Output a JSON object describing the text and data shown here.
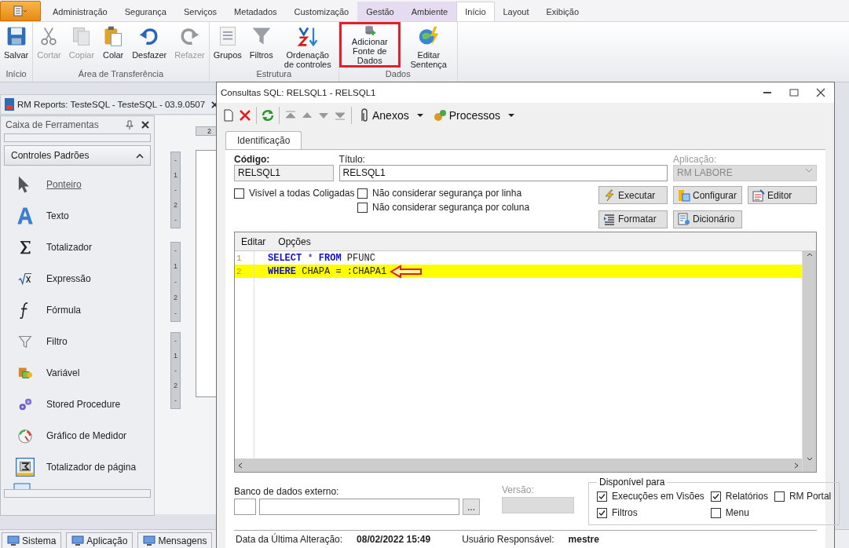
{
  "ribbon": {
    "tabs": [
      {
        "label": "Administração",
        "selected": false,
        "contextual": false
      },
      {
        "label": "Segurança",
        "selected": false,
        "contextual": false
      },
      {
        "label": "Serviços",
        "selected": false,
        "contextual": false
      },
      {
        "label": "Metadados",
        "selected": false,
        "contextual": false
      },
      {
        "label": "Customização",
        "selected": false,
        "contextual": false
      },
      {
        "label": "Gestão",
        "selected": false,
        "contextual": true
      },
      {
        "label": "Ambiente",
        "selected": false,
        "contextual": true
      },
      {
        "label": "Início",
        "selected": true,
        "contextual": false
      },
      {
        "label": "Layout",
        "selected": false,
        "contextual": false
      },
      {
        "label": "Exibição",
        "selected": false,
        "contextual": false
      }
    ],
    "groups": [
      {
        "label": "Início",
        "buttons": [
          {
            "label": "Salvar",
            "disabled": false,
            "highlighted": false
          }
        ]
      },
      {
        "label": "Área de Transferência",
        "buttons": [
          {
            "label": "Cortar",
            "disabled": true,
            "highlighted": false
          },
          {
            "label": "Copiar",
            "disabled": true,
            "highlighted": false
          },
          {
            "label": "Colar",
            "disabled": false,
            "highlighted": false
          },
          {
            "label": "Desfazer",
            "disabled": false,
            "highlighted": false
          },
          {
            "label": "Refazer",
            "disabled": true,
            "highlighted": false
          }
        ]
      },
      {
        "label": "Estrutura",
        "buttons": [
          {
            "label": "Grupos",
            "disabled": false,
            "highlighted": false
          },
          {
            "label": "Filtros",
            "disabled": false,
            "highlighted": false
          },
          {
            "label": "Ordenação de controles",
            "disabled": false,
            "highlighted": false
          }
        ]
      },
      {
        "label": "Dados",
        "buttons": [
          {
            "label": "Adicionar Fonte de Dados",
            "disabled": false,
            "highlighted": true
          },
          {
            "label": "Editar Sentença",
            "disabled": false,
            "highlighted": false
          }
        ]
      }
    ]
  },
  "document_tab": {
    "title": "RM Reports: TesteSQL - TesteSQL - 03.9.0507"
  },
  "toolbox": {
    "title": "Caixa de Ferramentas",
    "group": {
      "label": "Controles Padrões",
      "expanded": true
    },
    "items": [
      {
        "label": "Ponteiro",
        "selected": true
      },
      {
        "label": "Texto",
        "selected": false
      },
      {
        "label": "Totalizador",
        "selected": false
      },
      {
        "label": "Expressão",
        "selected": false
      },
      {
        "label": "Fórmula",
        "selected": false
      },
      {
        "label": "Filtro",
        "selected": false
      },
      {
        "label": "Variável",
        "selected": false
      },
      {
        "label": "Stored Procedure",
        "selected": false
      },
      {
        "label": "Gráfico de Medidor",
        "selected": false
      },
      {
        "label": "Totalizador de página",
        "selected": false
      }
    ]
  },
  "designer": {
    "top_ruler": "2",
    "bands": [
      {
        "marks": [
          "-",
          "1",
          "-",
          "2",
          "-"
        ]
      },
      {
        "marks": [
          "-",
          "1",
          "-",
          "2",
          "-"
        ]
      },
      {
        "marks": [
          "-",
          "1",
          "-",
          "2",
          "-"
        ]
      }
    ]
  },
  "status_bar": {
    "buttons": [
      "Sistema",
      "Aplicação",
      "Mensagens"
    ]
  },
  "dialog": {
    "title": "Consultas SQL: RELSQL1 - RELSQL1",
    "toolbar": {
      "menus": [
        "Anexos",
        "Processos"
      ]
    },
    "tabs": [
      {
        "label": "Identificação",
        "selected": true
      }
    ],
    "codigo": {
      "label": "Código:",
      "value": "RELSQL1"
    },
    "titulo": {
      "label": "Título:",
      "value": "RELSQL1"
    },
    "aplicacao": {
      "label": "Aplicação:",
      "value": "RM LABORE",
      "disabled": true
    },
    "options": [
      {
        "label": "Visível a todas Coligadas",
        "checked": false
      },
      {
        "label": "Não considerar segurança por linha",
        "checked": false
      },
      {
        "label": "Não considerar segurança por coluna",
        "checked": false
      }
    ],
    "buttons": [
      "Executar",
      "Configurar",
      "Editor",
      "Formatar",
      "Dicionário"
    ],
    "editor": {
      "menu": [
        "Editar",
        "Opções"
      ],
      "lines": [
        {
          "number": "1",
          "highlighted": false,
          "tokens": [
            {
              "text": "SELECT",
              "kind": "keyword"
            },
            {
              "text": "*",
              "kind": "operator"
            },
            {
              "text": "FROM",
              "kind": "keyword"
            },
            {
              "text": "PFUNC",
              "kind": "identifier"
            }
          ]
        },
        {
          "number": "2",
          "highlighted": true,
          "tokens": [
            {
              "text": "WHERE",
              "kind": "keyword"
            },
            {
              "text": "CHAPA",
              "kind": "identifier"
            },
            {
              "text": "=",
              "kind": "operator"
            },
            {
              "text": ":CHAPA1",
              "kind": "identifier"
            }
          ]
        }
      ]
    },
    "external_db": {
      "label": "Banco de dados externo:",
      "browse": "..."
    },
    "version": {
      "label": "Versão:",
      "disabled": true
    },
    "available": {
      "label": "Disponível para",
      "items": [
        {
          "label": "Execuções em Visões",
          "checked": true
        },
        {
          "label": "Relatórios",
          "checked": true
        },
        {
          "label": "RM Portal",
          "checked": false
        },
        {
          "label": "Filtros",
          "checked": true
        },
        {
          "label": "Menu",
          "checked": false
        }
      ]
    },
    "footer": [
      {
        "label": "Data da Última Alteração:",
        "value": "08/02/2022 15:49"
      },
      {
        "label": "Usuário Responsável:",
        "value": "mestre"
      }
    ]
  }
}
